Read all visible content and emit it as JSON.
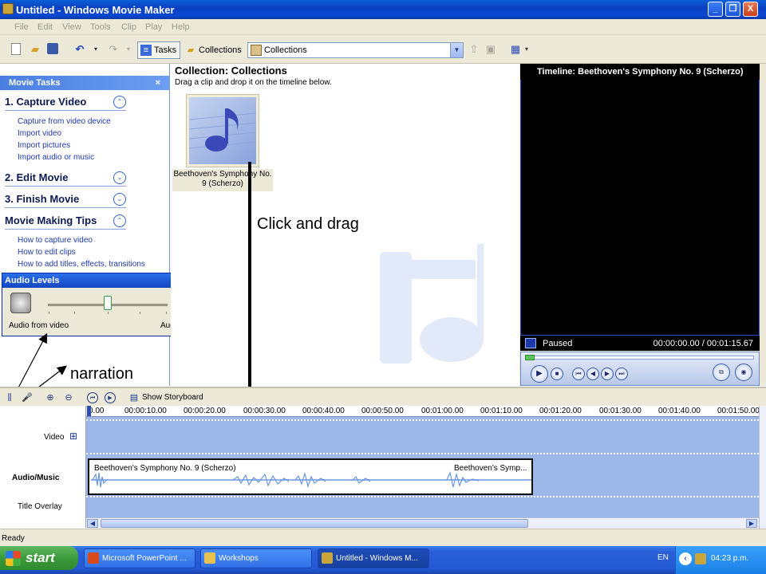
{
  "window": {
    "title": "Untitled - Windows Movie Maker",
    "buttons": {
      "minimize": "_",
      "restore": "❐",
      "close": "X"
    }
  },
  "menu": [
    "File",
    "Edit",
    "View",
    "Tools",
    "Clip",
    "Play",
    "Help"
  ],
  "toolbar": {
    "tasks_label": "Tasks",
    "collections_label": "Collections",
    "collections_selected": "Collections"
  },
  "task_pane": {
    "header": "Movie Tasks",
    "close_glyph": "×",
    "sections": [
      {
        "title": "1. Capture Video",
        "chevron": "⌃",
        "links": [
          "Capture from video device",
          "Import video",
          "Import pictures",
          "Import audio or music"
        ]
      },
      {
        "title": "2. Edit Movie",
        "chevron": "⌄",
        "links": []
      },
      {
        "title": "3. Finish Movie",
        "chevron": "⌄",
        "links": []
      },
      {
        "title": "Movie Making Tips",
        "chevron": "⌃",
        "links": [
          "How to capture video",
          "How to edit clips",
          "How to add titles, effects, transitions"
        ]
      }
    ]
  },
  "audio_levels": {
    "title": "Audio Levels",
    "left_label": "Audio from video",
    "right_label": "Audio/Music",
    "level": 0.5
  },
  "collection": {
    "title": "Collection: Collections",
    "subtitle": "Drag a clip and drop it on the timeline below.",
    "clip_caption": "Beethoven's Symphony No. 9 (Scherzo)"
  },
  "preview": {
    "title": "Timeline: Beethoven's Symphony No. 9 (Scherzo)",
    "status": "Paused",
    "time": "00:00:00.00 / 00:01:15.67"
  },
  "annotations": {
    "drag": "Click and drag",
    "narration": "narration"
  },
  "timeline": {
    "show_storyboard": "Show Storyboard",
    "ruler": [
      "0.00",
      "00:00:10.00",
      "00:00:20.00",
      "00:00:30.00",
      "00:00:40.00",
      "00:00:50.00",
      "00:01:00.00",
      "00:01:10.00",
      "00:01:20.00",
      "00:01:30.00",
      "00:01:40.00",
      "00:01:50.00"
    ],
    "tracks": {
      "video": "Video",
      "audio": "Audio/Music",
      "title_overlay": "Title Overlay"
    },
    "expand_glyph": "⊞",
    "audio_clip_label": "Beethoven's Symphony No. 9 (Scherzo)",
    "audio_clip_label_2": "Beethoven's Symp..."
  },
  "status_bar": "Ready",
  "taskbar": {
    "start": "start",
    "tasks": [
      "Microsoft PowerPoint ...",
      "Workshops",
      "Untitled - Windows M..."
    ],
    "language": "EN",
    "clock": "04:23 p.m."
  },
  "colors": {
    "accent": "#0a3fc0",
    "taskpane_link": "#1f3aa8",
    "timeline_track": "#9db8e8",
    "taskbar": "#245ad4"
  }
}
